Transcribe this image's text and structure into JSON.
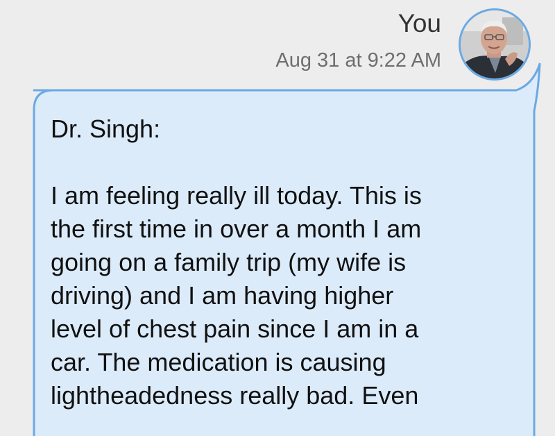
{
  "message": {
    "sender": "You",
    "timestamp": "Aug 31 at 9:22 AM",
    "avatar_icon": "user-photo-avatar",
    "salutation": "Dr. Singh:",
    "body": "I am feeling really ill today. This is\nthe first time in over a month I am\ngoing on a family trip (my wife is\ndriving) and I am having higher\nlevel of chest pain since I am in a\ncar. The medication is causing\nlightheadedness really bad. Even"
  },
  "colors": {
    "background": "#ededed",
    "bubble_fill": "#dcebfa",
    "bubble_border": "#6aa9e4",
    "name_text": "#333333",
    "timestamp_text": "#6e6e6e",
    "body_text": "#111111"
  }
}
